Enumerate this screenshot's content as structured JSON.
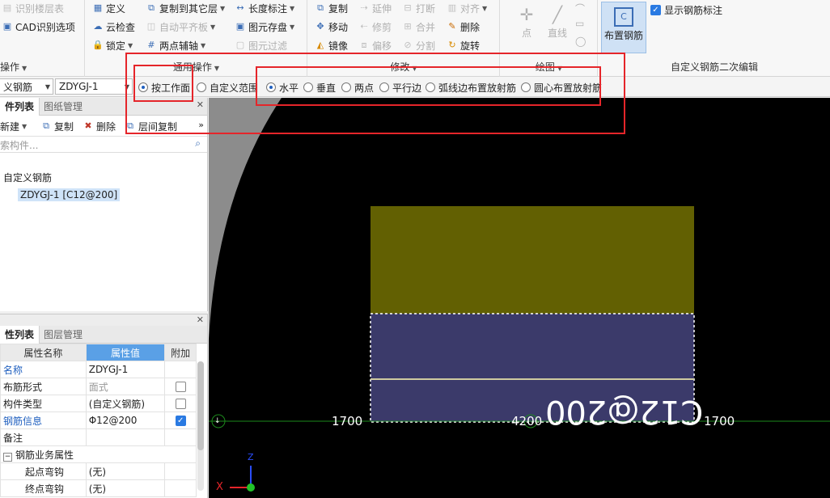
{
  "ribbon": {
    "group1": {
      "items": [
        "识别楼层表",
        "CAD识别选项"
      ],
      "title": "操作"
    },
    "group2": {
      "items": [
        "定义",
        "云检查",
        "锁定",
        "复制到其它层",
        "自动平齐板",
        "两点辅轴",
        "长度标注",
        "图元存盘",
        "图元过滤"
      ],
      "title": "通用操作"
    },
    "group3": {
      "items": [
        "复制",
        "移动",
        "镜像",
        "延伸",
        "修剪",
        "偏移",
        "打断",
        "合并",
        "分割",
        "对齐",
        "删除",
        "旋转"
      ],
      "title": "修改"
    },
    "group4": {
      "items": [
        "点",
        "直线"
      ],
      "title": "绘图"
    },
    "group5": {
      "button": "布置钢筋",
      "checkbox": "显示钢筋标注",
      "title": "自定义钢筋二次编辑"
    }
  },
  "optbar": {
    "combo1": "义钢筋",
    "combo2": "ZDYGJ-1",
    "radios": [
      "按工作面",
      "自定义范围",
      "水平",
      "垂直",
      "两点",
      "平行边",
      "弧线边布置放射筋",
      "圆心布置放射筋"
    ]
  },
  "component_panel": {
    "tabs": [
      "件列表",
      "图纸管理"
    ],
    "toolbar": [
      "新建",
      "复制",
      "删除",
      "层间复制"
    ],
    "search_placeholder": "索构件...",
    "tree_root": "自定义钢筋",
    "tree_child": "ZDYGJ-1 [C12@200]"
  },
  "property_panel": {
    "tabs": [
      "性列表",
      "图层管理"
    ],
    "headers": [
      "属性名称",
      "属性值",
      "附加"
    ],
    "rows": [
      {
        "name": "名称",
        "value": "ZDYGJ-1",
        "check": null,
        "blue": true
      },
      {
        "name": "布筋形式",
        "value": "面式",
        "check": false,
        "blue": false,
        "gray": true
      },
      {
        "name": "构件类型",
        "value": "(自定义钢筋)",
        "check": false,
        "blue": false
      },
      {
        "name": "钢筋信息",
        "value": "Φ12@200",
        "check": true,
        "blue": true
      },
      {
        "name": "备注",
        "value": "",
        "check": null,
        "blue": false
      },
      {
        "name": "钢筋业务属性",
        "value": "",
        "check": null,
        "blue": false,
        "group": true
      },
      {
        "name": "起点弯钩",
        "value": "(无)",
        "check": null,
        "blue": false,
        "indent": true
      },
      {
        "name": "终点弯钩",
        "value": "(无)",
        "check": null,
        "blue": false,
        "indent": true
      }
    ]
  },
  "canvas": {
    "dims": [
      "1700",
      "4200",
      "1700"
    ],
    "rebar_label": "C12@200",
    "axis_z": "Z",
    "axis_x": "X",
    "colors": {
      "top_rect": "#626002",
      "bottom_rect": "#3b3a6a",
      "grid_line": "#1c8a1c",
      "highlight": "#e5252a"
    }
  }
}
